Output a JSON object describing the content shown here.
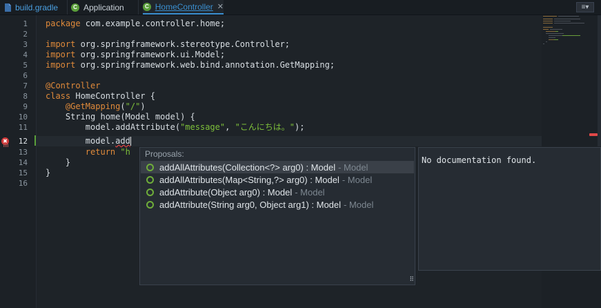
{
  "tabs": [
    {
      "label": "build.gradle",
      "icon": "gradle-file-icon"
    },
    {
      "label": "Application",
      "icon": "java-class-icon"
    },
    {
      "label": "HomeController",
      "icon": "java-class-icon",
      "active": true
    }
  ],
  "tab_close_glyph": "✕",
  "overflow_glyph": "≡▾",
  "error_marker_glyph": "✖",
  "gutter": {
    "line_numbers": [
      "1",
      "2",
      "3",
      "4",
      "5",
      "6",
      "7",
      "8",
      "9",
      "10",
      "11",
      "12",
      "13",
      "14",
      "15",
      "16"
    ],
    "current_line": "12"
  },
  "code": {
    "line1_kw": "package",
    "line1_rest": " com.example.controller.home;",
    "line3_kw": "import",
    "line3_rest": " org.springframework.stereotype.Controller;",
    "line4_kw": "import",
    "line4_rest": " org.springframework.ui.Model;",
    "line5_kw": "import",
    "line5_rest": " org.springframework.web.bind.annotation.GetMapping;",
    "line7_annotation": "@Controller",
    "line8_kw": "class",
    "line8_rest": " HomeController {",
    "line9_indent": "    ",
    "line9_annotation": "@GetMapping",
    "line9_paren_open": "(",
    "line9_str": "\"/\"",
    "line9_paren_close": ")",
    "line10": "    String home(Model model) {",
    "line11_pre": "        model.addAttribute(",
    "line11_str1": "\"message\"",
    "line11_sep": ", ",
    "line11_str2": "\"こんにちは。\"",
    "line11_post": ");",
    "line12_pre": "        model.",
    "line12_err": "add",
    "line13_indent": "        ",
    "line13_kw": "return",
    "line13_str": " \"h",
    "line14": "    }",
    "line15": "}"
  },
  "proposals": {
    "title": "Proposals:",
    "items": [
      {
        "label": "addAllAttributes(Collection<?> arg0) : Model",
        "type": " - Model",
        "selected": true
      },
      {
        "label": "addAllAttributes(Map<String,?> arg0) : Model",
        "type": " - Model"
      },
      {
        "label": "addAttribute(Object arg0) : Model",
        "type": " - Model"
      },
      {
        "label": "addAttribute(String arg0, Object arg1) : Model",
        "type": " - Model"
      }
    ],
    "resize_glyph": "⠿"
  },
  "documentation": {
    "text": "No documentation found."
  },
  "colors": {
    "keyword": "#e08a3a",
    "string": "#7ec03a",
    "accent": "#3a8fd0",
    "error": "#e04848"
  }
}
